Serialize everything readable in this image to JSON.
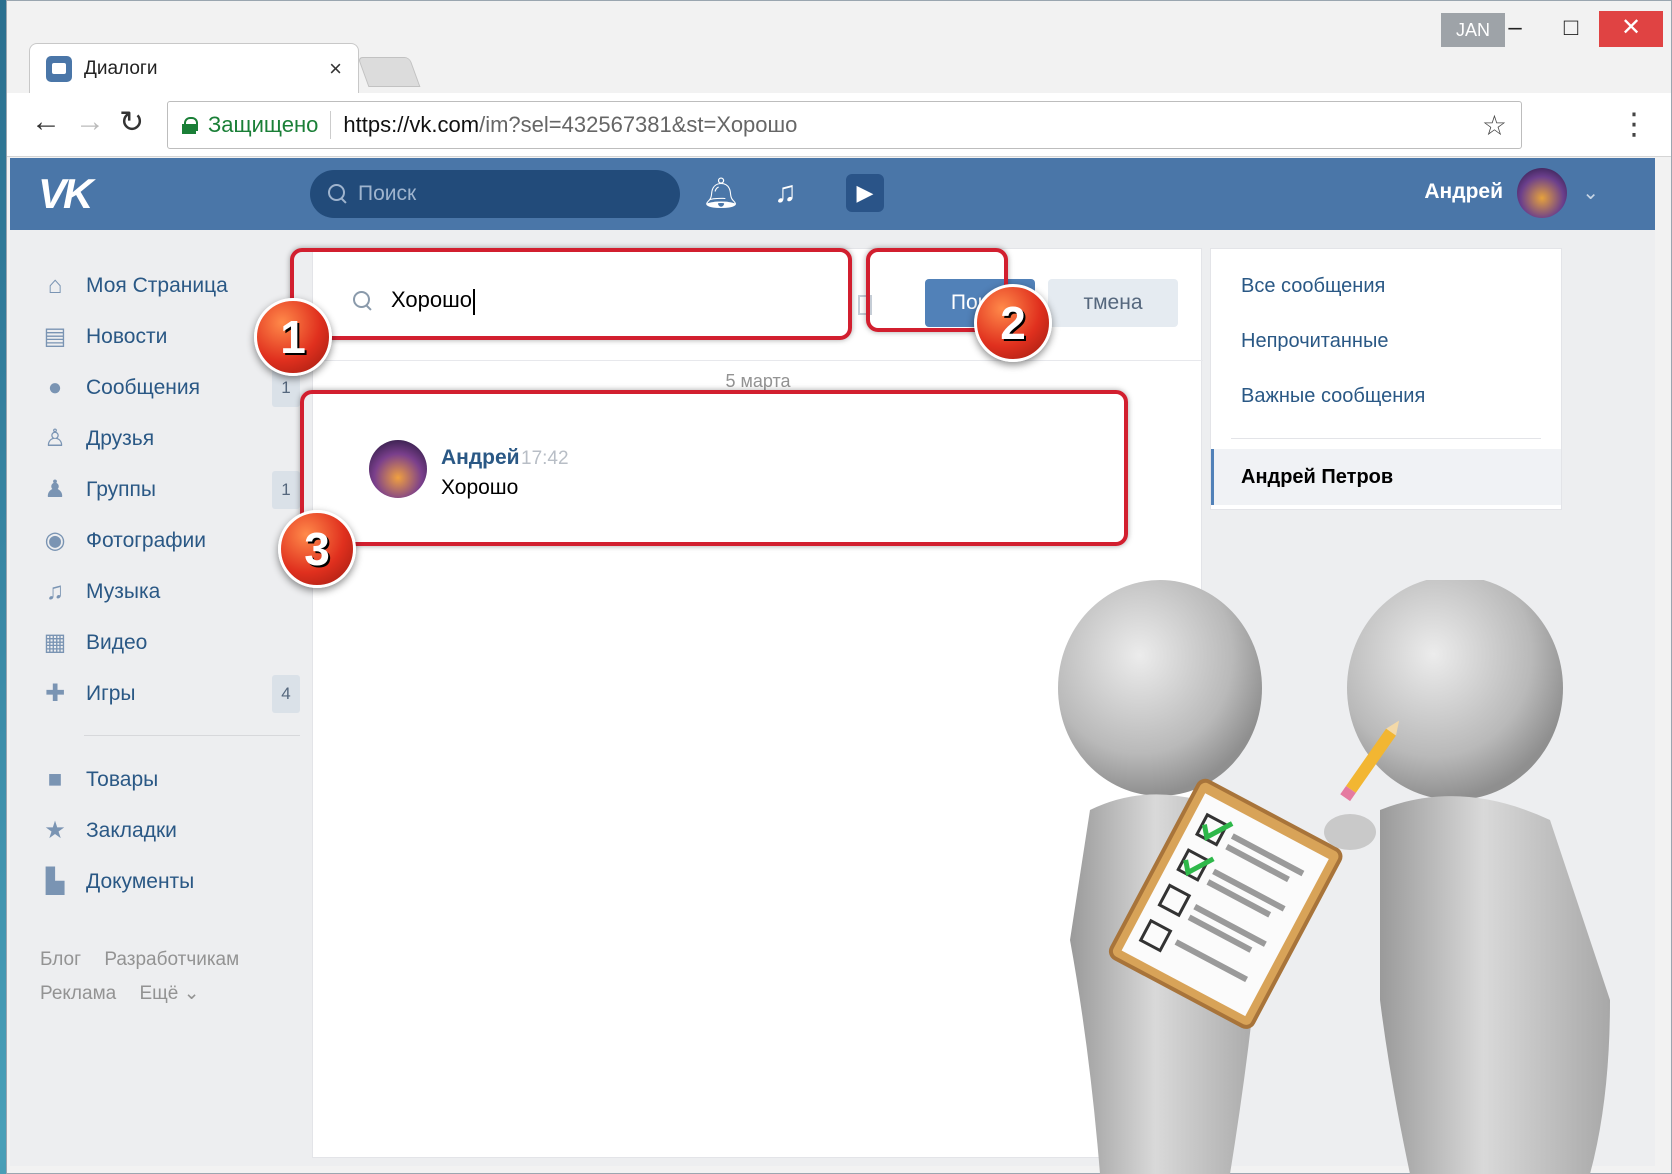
{
  "browser": {
    "tab_title": "Диалоги",
    "tab_close": "×",
    "badge": "JAN",
    "minimize": "–",
    "maximize": "□",
    "close": "✕",
    "secure_label": "Защищено",
    "url_host": "https://vk.com",
    "url_rest": "/im?sel=432567381&st=Хорошо"
  },
  "vk_header": {
    "logo": "VK",
    "search_placeholder": "Поиск",
    "user_name": "Андрей"
  },
  "left_menu": {
    "items": [
      {
        "label": "Моя Страница",
        "icon": "home-icon",
        "count": ""
      },
      {
        "label": "Новости",
        "icon": "news-icon",
        "count": ""
      },
      {
        "label": "Сообщения",
        "icon": "messages-icon",
        "count": "1"
      },
      {
        "label": "Друзья",
        "icon": "friends-icon",
        "count": ""
      },
      {
        "label": "Группы",
        "icon": "groups-icon",
        "count": "1"
      },
      {
        "label": "Фотографии",
        "icon": "camera-icon",
        "count": ""
      },
      {
        "label": "Музыка",
        "icon": "music-icon",
        "count": ""
      },
      {
        "label": "Видео",
        "icon": "video-icon",
        "count": ""
      },
      {
        "label": "Игры",
        "icon": "gamepad-icon",
        "count": "4"
      }
    ],
    "extra_items": [
      {
        "label": "Товары",
        "icon": "bag-icon"
      },
      {
        "label": "Закладки",
        "icon": "star-icon"
      },
      {
        "label": "Документы",
        "icon": "document-icon"
      }
    ],
    "footer": [
      "Блог",
      "Разработчикам",
      "Реклама",
      "Ещё ⌄"
    ]
  },
  "im": {
    "search_value": "Хорошо",
    "search_button": "Поиск",
    "cancel_button": "тмена",
    "date_label": "5 марта",
    "result": {
      "name": "Андрей",
      "time": "17:42",
      "text": "Хорошо"
    }
  },
  "right_menu": {
    "items": [
      "Все сообщения",
      "Непрочитанные",
      "Важные сообщения"
    ],
    "active": "Андрей Петров"
  },
  "annotations": [
    "1",
    "2",
    "3"
  ],
  "colors": {
    "vk_blue": "#4a76a8",
    "highlight_red": "#d21f2f",
    "link_blue": "#2a5885"
  }
}
